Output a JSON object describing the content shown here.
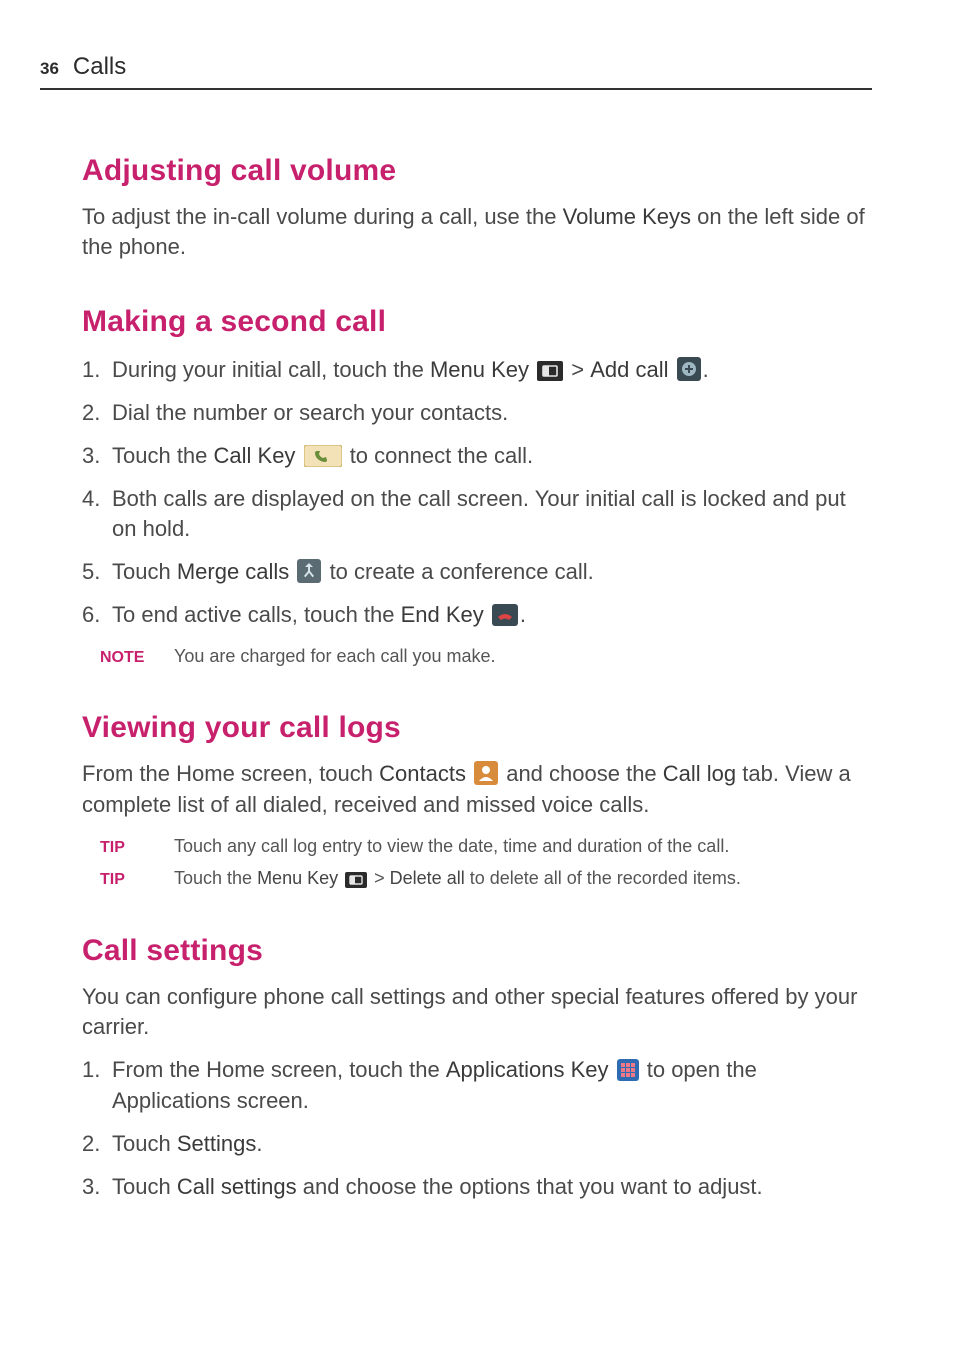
{
  "page": {
    "number": "36",
    "section": "Calls"
  },
  "h_adjust": "Adjusting call volume",
  "p_adjust_a": "To adjust the in-call volume during a call, use the ",
  "p_adjust_b_semi": "Volume Keys",
  "p_adjust_c": " on the left side of the phone.",
  "h_second": "Making a second call",
  "s2_1a": "During your initial call, touch the ",
  "s2_1b_semi": "Menu Key",
  "s2_1c": " > ",
  "s2_1d_semi": "Add call",
  "s2_1e": ".",
  "s2_2": "Dial the number or search your contacts.",
  "s2_3a": "Touch the ",
  "s2_3b_semi": "Call Key",
  "s2_3c": " to connect the call.",
  "s2_4": "Both calls are displayed on the call screen. Your initial call is locked and put on hold.",
  "s2_5a": "Touch ",
  "s2_5b_semi": "Merge calls",
  "s2_5c": " to create a conference call.",
  "s2_6a": "To end active calls, touch the ",
  "s2_6b_semi": "End Key",
  "s2_6c": ".",
  "note_label": "NOTE",
  "note_text": "You are charged for each call you make.",
  "h_logs": "Viewing your call logs",
  "logs_a": "From the Home screen, touch ",
  "logs_b_semi": "Contacts",
  "logs_c": " and choose the ",
  "logs_d_semi": "Call log",
  "logs_e": " tab. View a complete list of all dialed, received and missed voice calls.",
  "tip_label": "TIP",
  "tip1_text": "Touch any call log entry to view the date, time and duration of the call.",
  "tip2_a": "Touch the ",
  "tip2_b_semi": "Menu Key",
  "tip2_c": " > ",
  "tip2_d_semi": "Delete all",
  "tip2_e": " to delete all of the recorded items.",
  "h_settings": "Call settings",
  "cs_intro": "You can configure phone call settings and other special features offered by your carrier.",
  "cs_1a": "From the Home screen, touch the ",
  "cs_1b_semi": "Applications Key",
  "cs_1c": " to open the Applications screen.",
  "cs_2a": "Touch ",
  "cs_2b_semi": "Settings",
  "cs_2c": ".",
  "cs_3a": "Touch ",
  "cs_3b_semi": "Call settings",
  "cs_3c": " and choose the options that you want to adjust."
}
